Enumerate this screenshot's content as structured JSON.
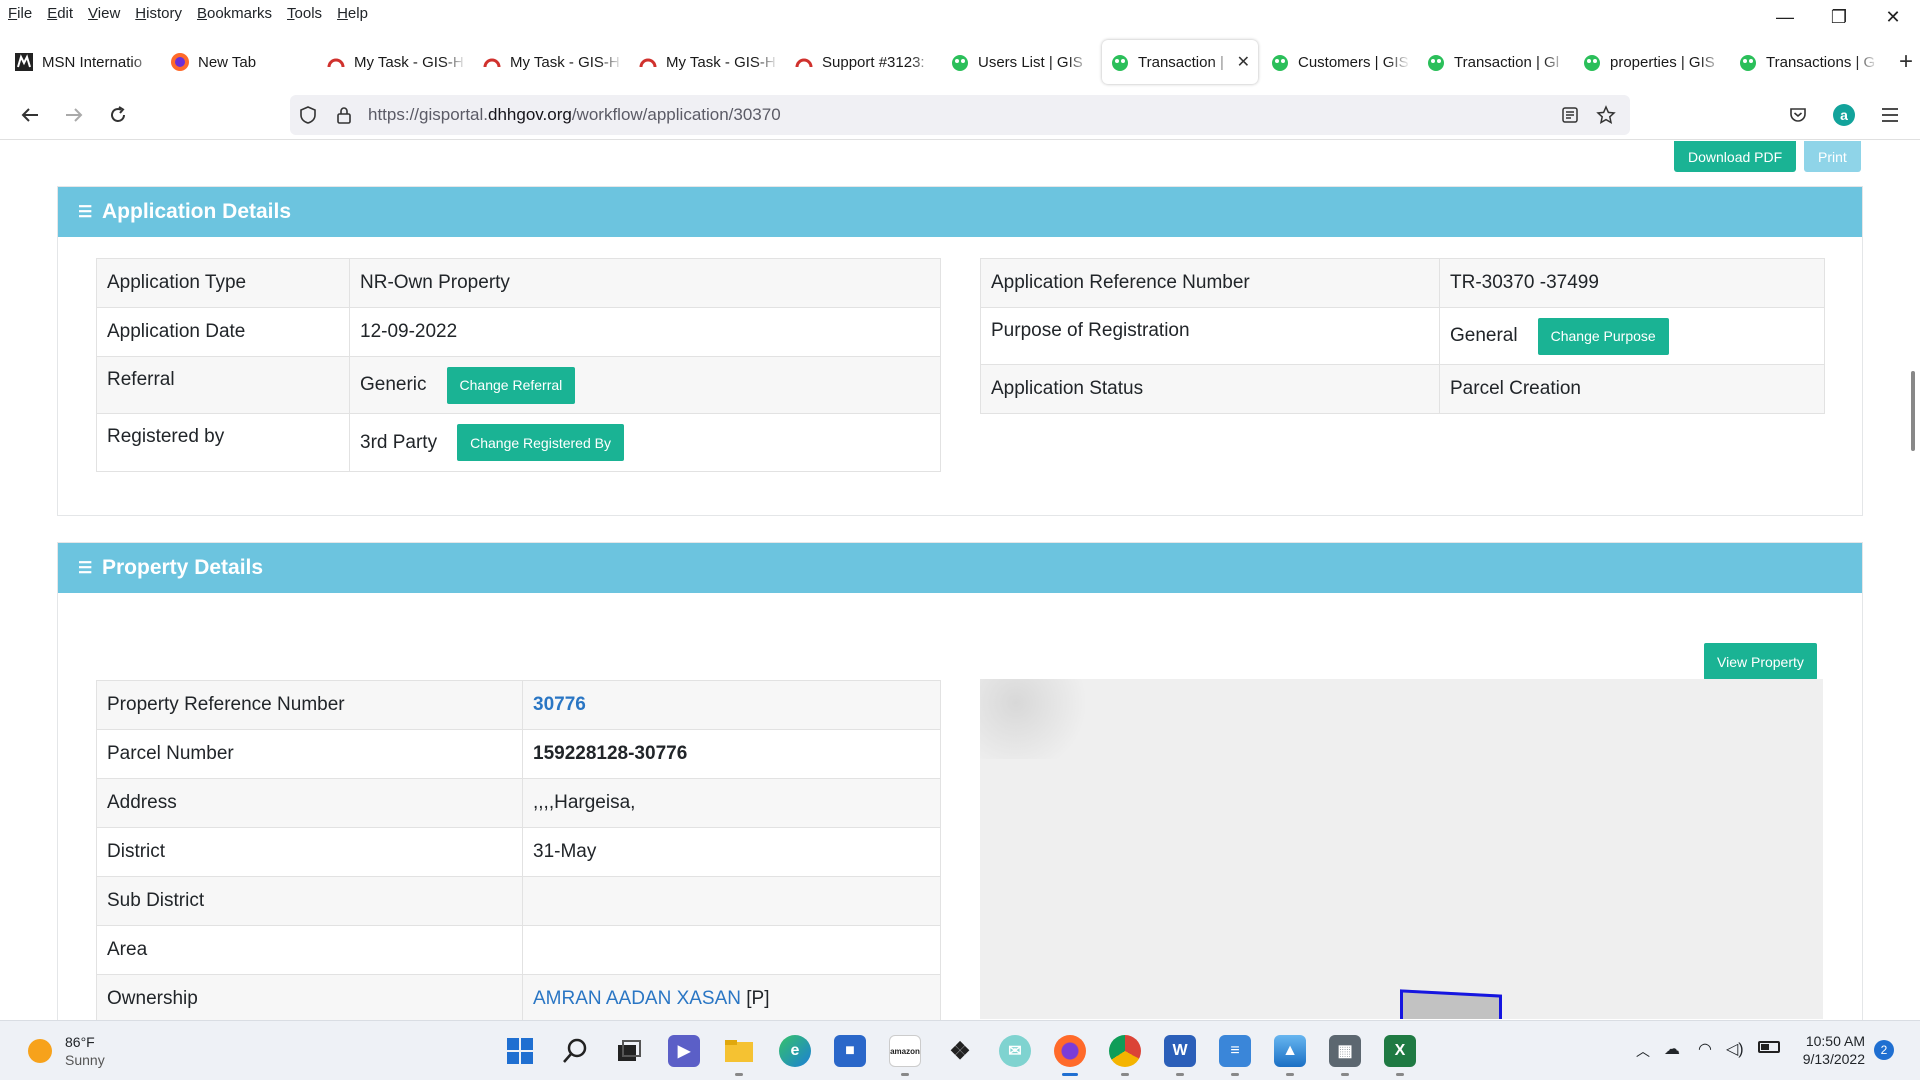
{
  "menu": [
    "File",
    "Edit",
    "View",
    "History",
    "Bookmarks",
    "Tools",
    "Help"
  ],
  "window_controls": {
    "minimize": "—",
    "restore": "❐",
    "close": "✕"
  },
  "tabs": [
    {
      "label": "MSN Internatio",
      "icon": "msn-icon"
    },
    {
      "label": "New Tab",
      "icon": "firefox-icon"
    },
    {
      "label": "My Task - GIS-H",
      "icon": "gis-task-icon"
    },
    {
      "label": "My Task - GIS-H",
      "icon": "gis-task-icon"
    },
    {
      "label": "My Task - GIS-H",
      "icon": "gis-task-icon"
    },
    {
      "label": "Support #3123:",
      "icon": "gis-task-icon"
    },
    {
      "label": "Users List | GIS",
      "icon": "frog-icon"
    },
    {
      "label": "Transaction |",
      "icon": "frog-icon",
      "active": true
    },
    {
      "label": "Customers | GIS",
      "icon": "frog-icon"
    },
    {
      "label": "Transaction | Gl",
      "icon": "frog-icon"
    },
    {
      "label": "properties | GIS",
      "icon": "frog-icon"
    },
    {
      "label": "Transactions | G",
      "icon": "frog-icon"
    }
  ],
  "url": {
    "prefix": "https://gisportal.",
    "domain": "dhhgov.org",
    "path": "/workflow/application/30370"
  },
  "top_buttons": {
    "download_pdf": "Download PDF",
    "print": "Print"
  },
  "application_details": {
    "title": "Application Details",
    "left_rows": [
      {
        "label": "Application Type",
        "value": "NR-Own Property"
      },
      {
        "label": "Application Date",
        "value": "12-09-2022"
      },
      {
        "label": "Referral",
        "value": "Generic",
        "button": "Change Referral"
      },
      {
        "label": "Registered by",
        "value": "3rd Party",
        "button": "Change Registered By"
      }
    ],
    "right_rows": [
      {
        "label": "Application Reference Number",
        "value": "TR-30370 -37499"
      },
      {
        "label": "Purpose of Registration",
        "value": "General",
        "button": "Change Purpose"
      },
      {
        "label": "Application Status",
        "value": "Parcel Creation"
      }
    ]
  },
  "property_details": {
    "title": "Property Details",
    "view_button": "View Property",
    "rows": [
      {
        "label": "Property Reference Number",
        "value": "30776"
      },
      {
        "label": "Parcel Number",
        "value": "159228128-30776"
      },
      {
        "label": "Address",
        "value": ",,,,Hargeisa,"
      },
      {
        "label": "District",
        "value": "31-May"
      },
      {
        "label": "Sub District",
        "value": ""
      },
      {
        "label": "Area",
        "value": ""
      },
      {
        "label": "Ownership",
        "value": "AMRAN AADAN XASAN",
        "suffix": " [P]"
      }
    ]
  },
  "taskbar": {
    "weather_temp": "86°F",
    "weather_desc": "Sunny",
    "time": "10:50 AM",
    "date": "9/13/2022",
    "notification_count": "2"
  },
  "colors": {
    "accent": "#1ab394",
    "panel_header": "#6cc4df",
    "link": "#2a76c4"
  }
}
